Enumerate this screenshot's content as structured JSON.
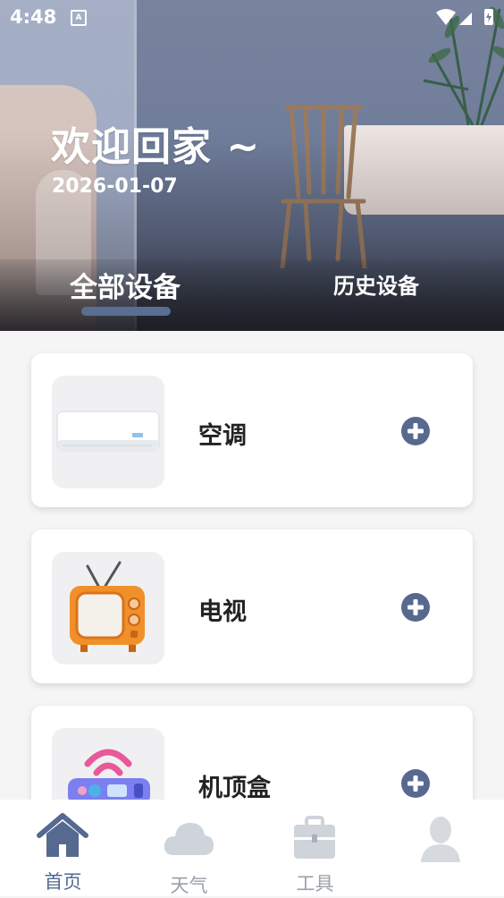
{
  "status_bar": {
    "time": "4:48",
    "notification_glyph": "A"
  },
  "header": {
    "welcome": "欢迎回家 ~",
    "date": "2026-01-07"
  },
  "tabs": [
    {
      "label": "全部设备",
      "active": true
    },
    {
      "label": "历史设备",
      "active": false
    }
  ],
  "devices": [
    {
      "name": "空调",
      "icon": "air-conditioner-image"
    },
    {
      "name": "电视",
      "icon": "tv-image"
    },
    {
      "name": "机顶盒",
      "icon": "set-top-box-image"
    }
  ],
  "bottom_nav": [
    {
      "label": "首页",
      "icon": "home-icon",
      "active": true
    },
    {
      "label": "天气",
      "icon": "cloud-icon",
      "active": false
    },
    {
      "label": "工具",
      "icon": "toolbox-icon",
      "active": false
    },
    {
      "label": "",
      "icon": "user-icon",
      "active": false
    }
  ],
  "colors": {
    "accent": "#5a6d93",
    "inactive": "#cfd3da",
    "add_button": "#56698f"
  }
}
